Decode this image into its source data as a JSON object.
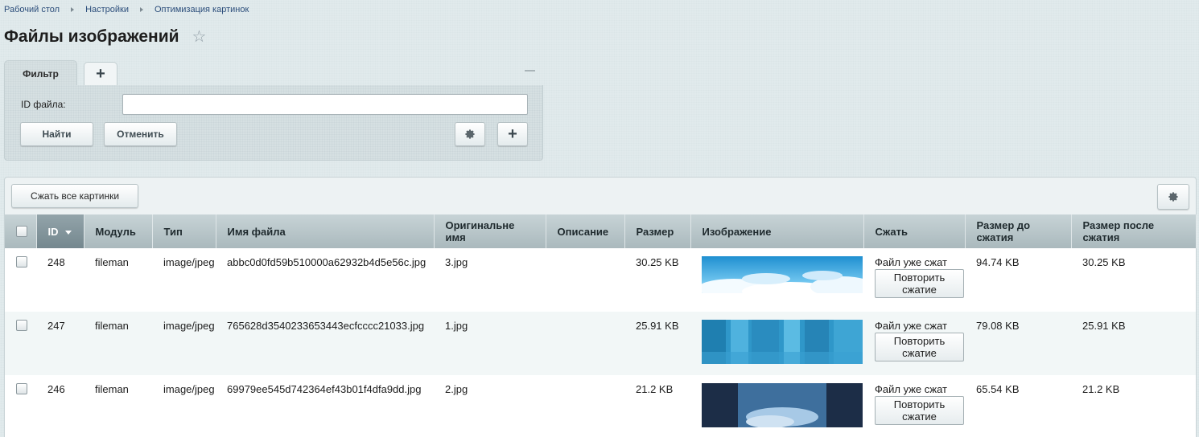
{
  "breadcrumb": [
    "Рабочий стол",
    "Настройки",
    "Оптимизация картинок"
  ],
  "page_title": "Файлы изображений",
  "filter": {
    "tab_label": "Фильтр",
    "field_label": "ID файла:",
    "field_value": "",
    "find_label": "Найти",
    "cancel_label": "Отменить"
  },
  "list": {
    "compress_all_label": "Сжать все картинки",
    "columns": [
      "ID",
      "Модуль",
      "Тип",
      "Имя файла",
      "Оригинальне имя",
      "Описание",
      "Размер",
      "Изображение",
      "Сжать",
      "Размер до сжатия",
      "Размер после сжатия"
    ],
    "rows": [
      {
        "id": "248",
        "module": "fileman",
        "type": "image/jpeg",
        "filename": "abbc0d0fd59b510000a62932b4d5e56c.jpg",
        "original": "3.jpg",
        "description": "",
        "size": "30.25 KB",
        "status": "Файл уже сжат",
        "action": "Повторить сжатие",
        "size_before": "94.74 KB",
        "size_after": "30.25 KB",
        "image": "sky-clouds"
      },
      {
        "id": "247",
        "module": "fileman",
        "type": "image/jpeg",
        "filename": "765628d3540233653443ecfcccc21033.jpg",
        "original": "1.jpg",
        "description": "",
        "size": "25.91 KB",
        "status": "Файл уже сжат",
        "action": "Повторить сжатие",
        "size_before": "79.08 KB",
        "size_after": "25.91 KB",
        "image": "server-racks-blue"
      },
      {
        "id": "246",
        "module": "fileman",
        "type": "image/jpeg",
        "filename": "69979ee545d742364ef43b01f4dfa9dd.jpg",
        "original": "2.jpg",
        "description": "",
        "size": "21.2 KB",
        "status": "Файл уже сжат",
        "action": "Повторить сжатие",
        "size_before": "65.54 KB",
        "size_after": "21.2 KB",
        "image": "server-racks-clouds"
      }
    ]
  }
}
